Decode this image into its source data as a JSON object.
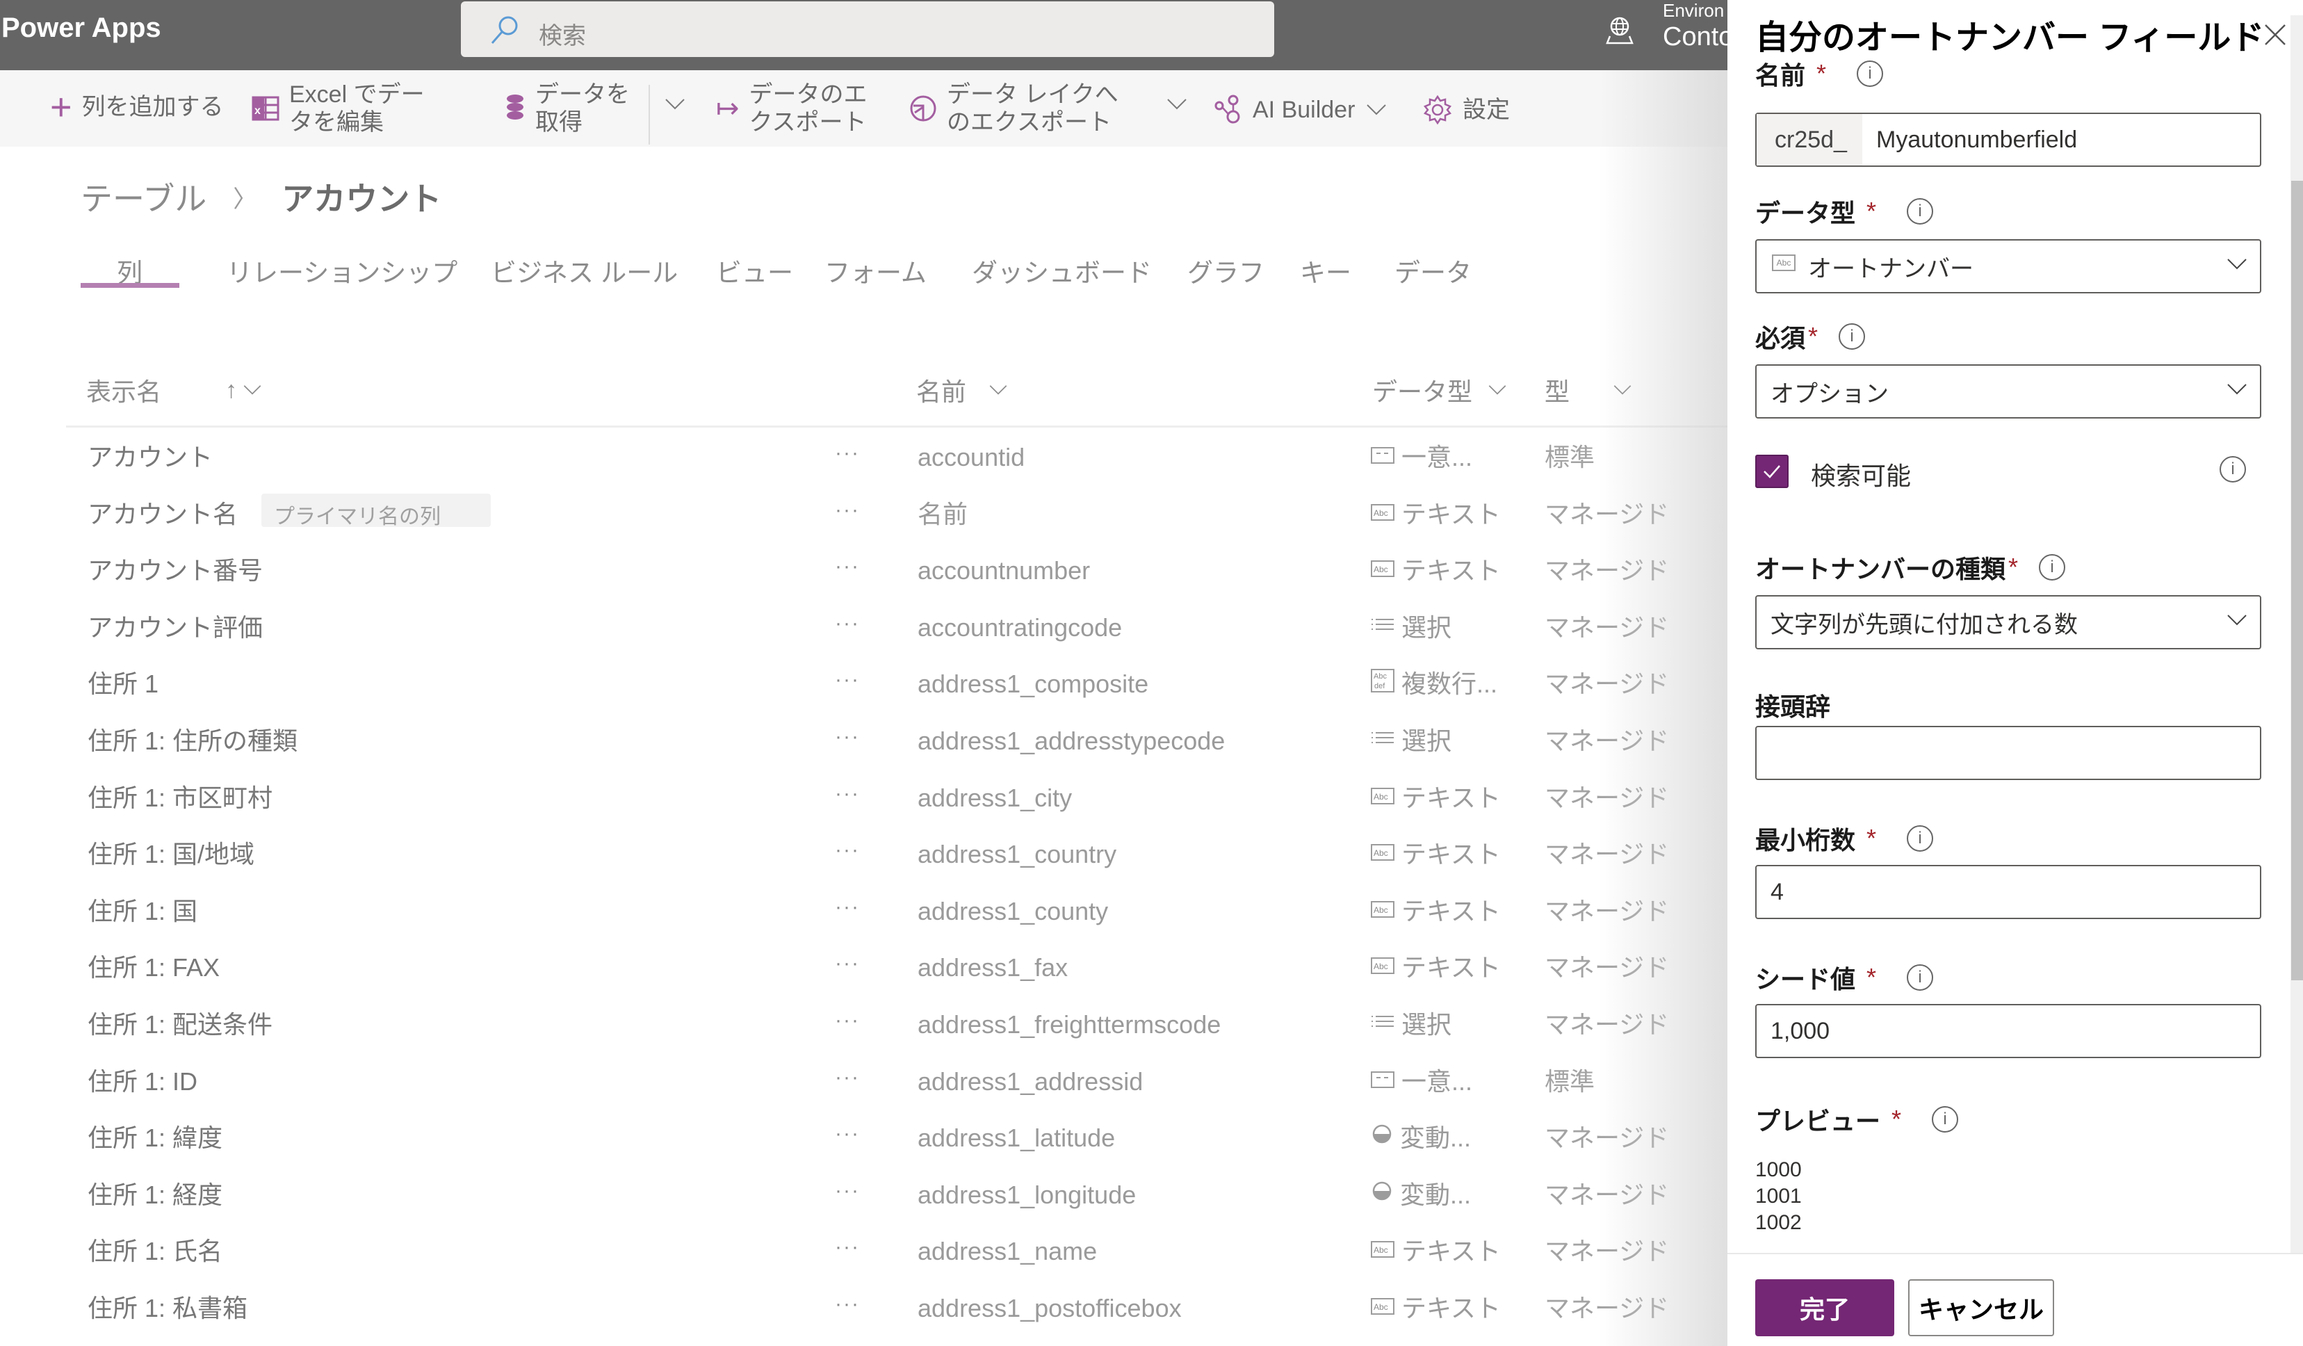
{
  "app": {
    "title": "Power Apps"
  },
  "search": {
    "placeholder": "検索"
  },
  "environment": {
    "label": "Environ",
    "name": "Conto"
  },
  "commands": {
    "add_column": "列を追加する",
    "edit_excel_line1": "Excel でデー",
    "edit_excel_line2": "タを編集",
    "get_data_line1": "データを",
    "get_data_line2": "取得",
    "export_line1": "データのエ",
    "export_line2": "クスポート",
    "lake_line1": "データ レイクへ",
    "lake_line2": "のエクスポート",
    "ai_builder": "AI Builder",
    "settings": "設定"
  },
  "breadcrumb": {
    "parent": "テーブル",
    "current": "アカウント"
  },
  "tabs": [
    "列",
    "リレーションシップ",
    "ビジネス ルール",
    "ビュー",
    "フォーム",
    "ダッシュボード",
    "グラフ",
    "キー",
    "データ"
  ],
  "active_tab": "列",
  "table": {
    "headers": {
      "display_name": "表示名",
      "name": "名前",
      "data_type": "データ型",
      "type": "型"
    },
    "rows": [
      {
        "display": "アカウント",
        "badge": "",
        "name": "accountid",
        "icon": "unique-id-icon",
        "icon_text": "--",
        "data_type": "一意...",
        "kind": "標準"
      },
      {
        "display": "アカウント名",
        "badge": "プライマリ名の列",
        "name": "名前",
        "icon": "text-icon",
        "icon_text": "Abc",
        "data_type": "テキスト",
        "kind": "マネージド"
      },
      {
        "display": "アカウント番号",
        "badge": "",
        "name": "accountnumber",
        "icon": "text-icon",
        "icon_text": "Abc",
        "data_type": "テキスト",
        "kind": "マネージド"
      },
      {
        "display": "アカウント評価",
        "badge": "",
        "name": "accountratingcode",
        "icon": "choice-icon",
        "icon_text": "≡",
        "data_type": "選択",
        "kind": "マネージド"
      },
      {
        "display": "住所 1",
        "badge": "",
        "name": "address1_composite",
        "icon": "multiline-text-icon",
        "icon_text": "Abc def",
        "data_type": "複数行...",
        "kind": "マネージド"
      },
      {
        "display": "住所 1: 住所の種類",
        "badge": "",
        "name": "address1_addresstypecode",
        "icon": "choice-icon",
        "icon_text": "≡",
        "data_type": "選択",
        "kind": "マネージド"
      },
      {
        "display": "住所 1: 市区町村",
        "badge": "",
        "name": "address1_city",
        "icon": "text-icon",
        "icon_text": "Abc",
        "data_type": "テキスト",
        "kind": "マネージド"
      },
      {
        "display": "住所 1: 国/地域",
        "badge": "",
        "name": "address1_country",
        "icon": "text-icon",
        "icon_text": "Abc",
        "data_type": "テキスト",
        "kind": "マネージド"
      },
      {
        "display": "住所 1: 国",
        "badge": "",
        "name": "address1_county",
        "icon": "text-icon",
        "icon_text": "Abc",
        "data_type": "テキスト",
        "kind": "マネージド"
      },
      {
        "display": "住所 1: FAX",
        "badge": "",
        "name": "address1_fax",
        "icon": "text-icon",
        "icon_text": "Abc",
        "data_type": "テキスト",
        "kind": "マネージド"
      },
      {
        "display": "住所 1: 配送条件",
        "badge": "",
        "name": "address1_freighttermscode",
        "icon": "choice-icon",
        "icon_text": "≡",
        "data_type": "選択",
        "kind": "マネージド"
      },
      {
        "display": "住所 1: ID",
        "badge": "",
        "name": "address1_addressid",
        "icon": "unique-id-icon",
        "icon_text": "--",
        "data_type": "一意...",
        "kind": "標準"
      },
      {
        "display": "住所 1: 緯度",
        "badge": "",
        "name": "address1_latitude",
        "icon": "float-icon",
        "icon_text": "◒",
        "data_type": "変動...",
        "kind": "マネージド"
      },
      {
        "display": "住所 1: 経度",
        "badge": "",
        "name": "address1_longitude",
        "icon": "float-icon",
        "icon_text": "◒",
        "data_type": "変動...",
        "kind": "マネージド"
      },
      {
        "display": "住所 1: 氏名",
        "badge": "",
        "name": "address1_name",
        "icon": "text-icon",
        "icon_text": "Abc",
        "data_type": "テキスト",
        "kind": "マネージド"
      },
      {
        "display": "住所 1: 私書箱",
        "badge": "",
        "name": "address1_postofficebox",
        "icon": "text-icon",
        "icon_text": "Abc",
        "data_type": "テキスト",
        "kind": "マネージド"
      }
    ]
  },
  "panel": {
    "title": "自分のオートナンバー フィールド",
    "name_label": "名前",
    "name_prefix": "cr25d_",
    "name_value": "Myautonumberfield",
    "data_type_label": "データ型",
    "data_type_value": "オートナンバー",
    "required_label": "必須",
    "required_value": "オプション",
    "searchable_label": "検索可能",
    "searchable_checked": true,
    "autonumber_type_label": "オートナンバーの種類",
    "autonumber_type_value": "文字列が先頭に付加される数",
    "prefix_label": "接頭辞",
    "prefix_value": "",
    "min_digits_label": "最小桁数",
    "min_digits_value": "4",
    "seed_label": "シード値",
    "seed_value": "1,000",
    "preview_label": "プレビュー",
    "preview_values": [
      "1000",
      "1001",
      "1002"
    ],
    "done_label": "完了",
    "cancel_label": "キャンセル",
    "required_marker": "*",
    "info_glyph": "i"
  },
  "colors": {
    "accent": "#742774",
    "icon_accent": "#a35ea0",
    "appbar": "#656565",
    "required": "#a4262c"
  }
}
